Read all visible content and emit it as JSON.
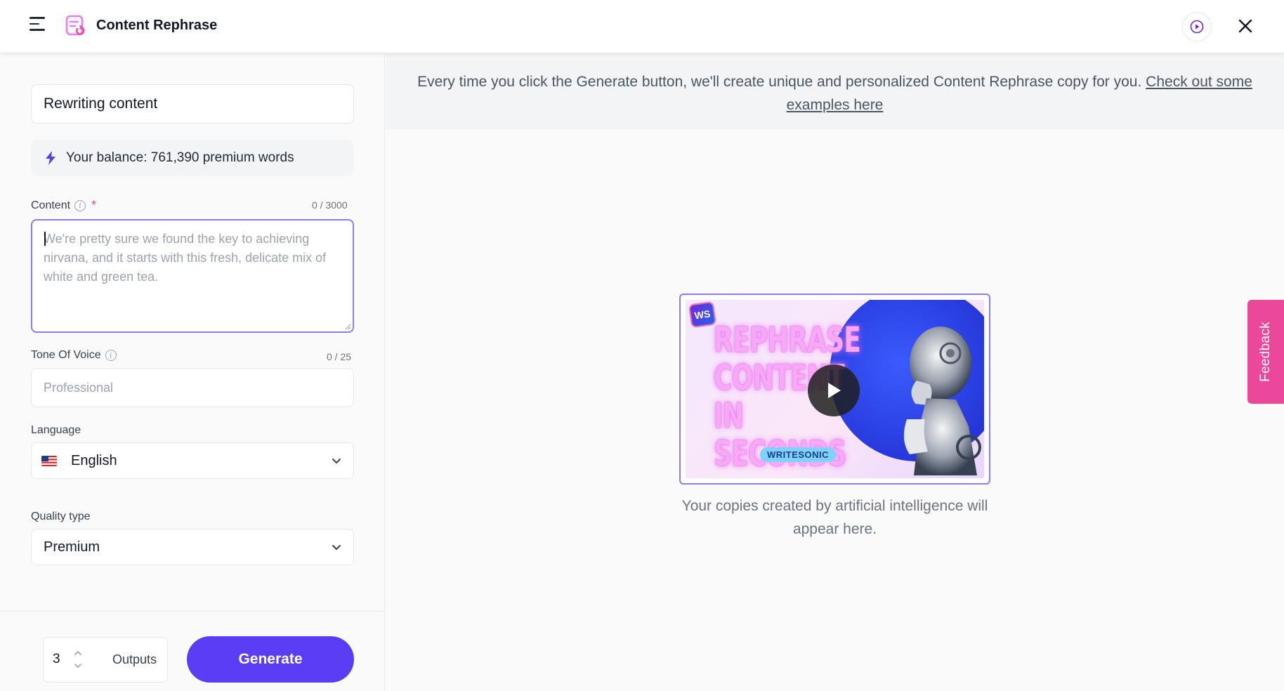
{
  "header": {
    "title": "Content Rephrase"
  },
  "form": {
    "title_value": "Rewriting content",
    "balance_text": "Your balance: 761,390 premium words",
    "content": {
      "label": "Content",
      "required_mark": "*",
      "counter": "0 / 3000",
      "placeholder": "We're pretty sure we found the key to achieving nirvana, and it starts with this fresh, delicate mix of white and green tea."
    },
    "tone": {
      "label": "Tone Of Voice",
      "counter": "0 / 25",
      "placeholder": "Professional"
    },
    "language": {
      "label": "Language",
      "value": "English"
    },
    "quality": {
      "label": "Quality type",
      "value": "Premium"
    },
    "outputs": {
      "value": "3",
      "label": "Outputs"
    },
    "generate_label": "Generate"
  },
  "main": {
    "banner_text": "Every time you click the Generate button, we'll create unique and personalized Content Rephrase copy for you.",
    "banner_link": "Check out some examples here",
    "video": {
      "logo_text": "WS",
      "title_text": "REPHRASE CONTENT IN SECONDS",
      "brand_text": "WRITESONIC"
    },
    "caption": "Your copies created by artificial intelligence will appear here."
  },
  "feedback_label": "Feedback",
  "colors": {
    "accent": "#5b3df5",
    "focus_border": "#8b7cf6",
    "feedback": "#ec4899",
    "required": "#ec4899"
  }
}
